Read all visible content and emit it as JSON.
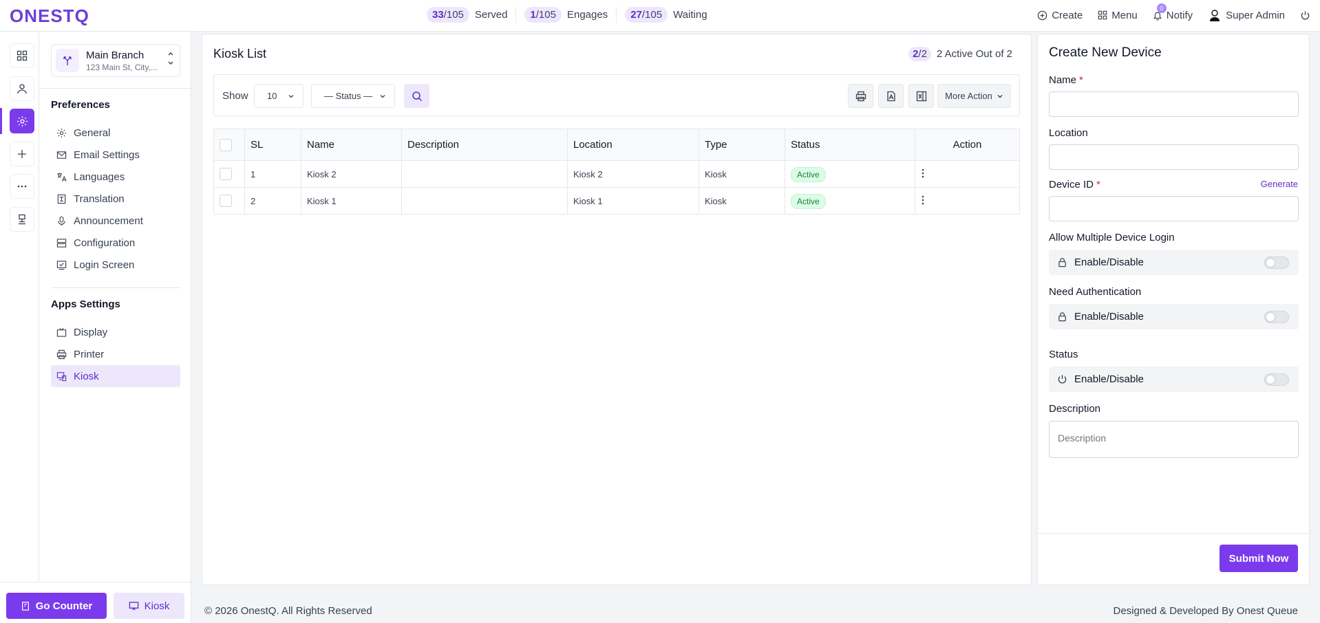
{
  "brand": {
    "logo_text": "ONESTQ",
    "accent": "#7c3aed"
  },
  "header": {
    "stats": [
      {
        "count": "33",
        "total": "/105",
        "label": "Served"
      },
      {
        "count": "1",
        "total": "/105",
        "label": "Engages"
      },
      {
        "count": "27",
        "total": "/105",
        "label": "Waiting"
      }
    ],
    "create_label": "Create",
    "menu_label": "Menu",
    "notify_label": "Notify",
    "notify_count": "0",
    "user_name": "Super Admin"
  },
  "branch": {
    "name": "Main Branch",
    "address": "123 Main St, City,..."
  },
  "sidebar": {
    "preferences_title": "Preferences",
    "preferences": [
      "General",
      "Email Settings",
      "Languages",
      "Translation",
      "Announcement",
      "Configuration",
      "Login Screen"
    ],
    "apps_title": "Apps Settings",
    "apps": [
      "Display",
      "Printer",
      "Kiosk"
    ]
  },
  "bottom": {
    "go_counter_label": "Go Counter",
    "kiosk_label": "Kiosk"
  },
  "main": {
    "title": "Kiosk List",
    "active_pill": {
      "count": "2",
      "total": "/2"
    },
    "active_text": "2 Active Out of 2",
    "toolbar": {
      "show_label": "Show",
      "page_size": "10",
      "status_filter": "— Status —",
      "more_action_label": "More Action"
    },
    "table": {
      "columns": [
        "SL",
        "Name",
        "Description",
        "Location",
        "Type",
        "Status",
        "Action"
      ],
      "rows": [
        {
          "sl": "1",
          "name": "Kiosk 2",
          "description": "",
          "location": "Kiosk 2",
          "type": "Kiosk",
          "status": "Active"
        },
        {
          "sl": "2",
          "name": "Kiosk 1",
          "description": "",
          "location": "Kiosk 1",
          "type": "Kiosk",
          "status": "Active"
        }
      ]
    }
  },
  "form": {
    "title": "Create New Device",
    "name_label": "Name",
    "required_mark": "*",
    "location_label": "Location",
    "device_id_label": "Device ID",
    "generate_label": "Generate",
    "multi_login_label": "Allow Multiple Device Login",
    "auth_label": "Need Authentication",
    "status_label": "Status",
    "toggle_text": "Enable/Disable",
    "description_label": "Description",
    "description_placeholder": "Description",
    "submit_label": "Submit Now"
  },
  "footer": {
    "copyright": "© 2026 OnestQ. All Rights Reserved",
    "credit": "Designed & Developed By Onest Queue"
  }
}
